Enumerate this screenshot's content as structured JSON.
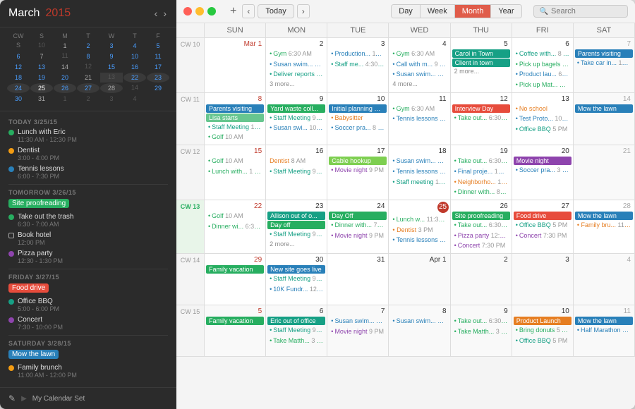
{
  "sidebar": {
    "title": "March",
    "year": "2015",
    "today_label": "TODAY 3/25/15",
    "tomorrow_label": "TOMORROW 3/26/15",
    "friday_label": "FRIDAY 3/27/15",
    "saturday_label": "SATURDAY 3/28/15",
    "today_events": [
      {
        "name": "Lunch with Eric",
        "time": "11:30 AM - 12:30 PM",
        "color": "green"
      },
      {
        "name": "Dentist",
        "time": "3:00 - 4:00 PM",
        "color": "yellow"
      },
      {
        "name": "Tennis lessons",
        "time": "6:00 - 7:30 PM",
        "color": "blue"
      }
    ],
    "tomorrow_events": [
      {
        "name": "Site proofreading",
        "time": "all-day",
        "color": "green",
        "allday": true
      },
      {
        "name": "Take out the trash",
        "time": "6:30 - 7:00 AM",
        "color": "green"
      },
      {
        "name": "Book hotel",
        "time": "12:00 PM",
        "color": "square"
      },
      {
        "name": "Pizza party",
        "time": "12:30 - 1:30 PM",
        "color": "purple"
      }
    ],
    "friday_events": [
      {
        "name": "Food drive",
        "time": "all-day",
        "color": "red",
        "allday": true
      },
      {
        "name": "Office BBQ",
        "time": "5:00 - 6:00 PM",
        "color": "teal"
      },
      {
        "name": "Concert",
        "time": "7:30 - 10:00 PM",
        "color": "purple"
      }
    ],
    "saturday_events": [
      {
        "name": "Mow the lawn",
        "time": "all-day",
        "color": "blue",
        "allday": true
      },
      {
        "name": "Family brunch",
        "time": "11:00 AM - 12:00 PM",
        "color": "yellow"
      }
    ],
    "footer": "My Calendar Set"
  },
  "toolbar": {
    "today_btn": "Today",
    "views": [
      "Day",
      "Week",
      "Month",
      "Year"
    ],
    "active_view": "Month",
    "search_placeholder": "Search",
    "add_icon": "+"
  },
  "calendar": {
    "day_headers": [
      "CW",
      "SUN",
      "MON",
      "TUE",
      "WED",
      "THU",
      "FRI",
      "SAT"
    ],
    "weeks": [
      {
        "cw": "CW 10",
        "days": [
          {
            "num": "Mar 1",
            "events": []
          },
          {
            "num": "2",
            "events": [
              {
                "text": "Gym 6:30 AM",
                "color": "green"
              },
              {
                "text": "Susan swim... 9 AM",
                "color": "blue"
              },
              {
                "text": "Deliver reports 9 AM",
                "color": "teal"
              },
              {
                "text": "3 more...",
                "more": true
              }
            ]
          },
          {
            "num": "3",
            "events": [
              {
                "text": "Production... 11 AM",
                "color": "blue"
              },
              {
                "text": "Staff me... 4:30 PM",
                "color": "teal"
              }
            ]
          },
          {
            "num": "4",
            "events": [
              {
                "text": "Gym 6:30 AM",
                "color": "green"
              },
              {
                "text": "Call with m... 9 AM",
                "color": "blue"
              },
              {
                "text": "Susan swim... 9 AM",
                "color": "blue"
              },
              {
                "text": "4 more...",
                "more": true
              }
            ]
          },
          {
            "num": "5",
            "events": [
              {
                "text": "Carol in Town",
                "color": "block-teal"
              },
              {
                "text": "Client in town",
                "color": "block-teal"
              },
              {
                "text": "2 more...",
                "more": true
              }
            ]
          },
          {
            "num": "6",
            "events": [
              {
                "text": "Coffee with... 8 AM",
                "color": "teal"
              },
              {
                "text": "Pick up bagels 9 AM",
                "color": "green"
              },
              {
                "text": "Product lau... 6:30 AM",
                "color": "blue"
              },
              {
                "text": "Pick up Mat... 10 AM",
                "color": "green"
              }
            ]
          },
          {
            "num": "7",
            "events": [
              {
                "text": "Parents visiting",
                "color": "block-blue"
              },
              {
                "text": "Take car in... 12 PM",
                "color": "blue"
              }
            ]
          }
        ]
      },
      {
        "cw": "CW 11",
        "days": [
          {
            "num": "8",
            "events": [
              {
                "text": "Parents visiting",
                "color": "block-blue"
              },
              {
                "text": "Golf 10 AM",
                "color": "green"
              },
              {
                "text": "Staff Meeting 10 AM",
                "color": "teal"
              },
              {
                "text": "Golf 10 AM",
                "color": "green"
              }
            ]
          },
          {
            "num": "9",
            "events": [
              {
                "text": "Yard waste coll... ",
                "color": "block-green"
              },
              {
                "text": "Staff Meeting 9 AM",
                "color": "teal"
              },
              {
                "text": "Susan swi... 10 AM",
                "color": "blue"
              }
            ]
          },
          {
            "num": "10",
            "events": [
              {
                "text": "Initial planning meeting",
                "color": "block-blue"
              },
              {
                "text": "Babysitter",
                "color": "orange"
              },
              {
                "text": "Soccer pra... 8 PM",
                "color": "blue"
              }
            ]
          },
          {
            "num": "11",
            "events": [
              {
                "text": "Gym 6:30 AM",
                "color": "green"
              },
              {
                "text": "Tennis lessons 6 PM",
                "color": "blue"
              }
            ]
          },
          {
            "num": "12",
            "events": [
              {
                "text": "Interview Day",
                "color": "block-red"
              },
              {
                "text": "Take out... 6:30 AM",
                "color": "green"
              }
            ]
          },
          {
            "num": "13",
            "events": [
              {
                "text": "No school",
                "color": "orange"
              },
              {
                "text": "Test Proto... 10 AM",
                "color": "blue"
              },
              {
                "text": "Office BBQ 5 PM",
                "color": "teal"
              }
            ]
          },
          {
            "num": "14",
            "events": [
              {
                "text": "Mow the lawn",
                "color": "block-blue"
              }
            ]
          }
        ]
      },
      {
        "cw": "CW 12",
        "days": [
          {
            "num": "15",
            "events": [
              {
                "text": "Golf 10 AM",
                "color": "green"
              },
              {
                "text": "Lunch with... 1 PM",
                "color": "green"
              }
            ]
          },
          {
            "num": "16",
            "events": [
              {
                "text": "Dentist 8 AM",
                "color": "yellow"
              },
              {
                "text": "Staff Meeting 9 AM",
                "color": "teal"
              }
            ]
          },
          {
            "num": "17",
            "events": [
              {
                "text": "Cable hookup",
                "color": "block-lime"
              },
              {
                "text": "Movie night 9 PM",
                "color": "purple"
              }
            ]
          },
          {
            "num": "18",
            "events": [
              {
                "text": "Susan swim... 8 AM",
                "color": "blue"
              },
              {
                "text": "Tennis lessons 9 PM",
                "color": "blue"
              },
              {
                "text": "Staff meeting 1 PM",
                "color": "teal"
              }
            ]
          },
          {
            "num": "19",
            "events": [
              {
                "text": "Take out... 6:30 AM",
                "color": "green"
              },
              {
                "text": "1 Final proje... 12 PM",
                "color": "blue"
              },
              {
                "text": "Neighborho... 1 PM",
                "color": "orange"
              },
              {
                "text": "Dinner with... 8 PM",
                "color": "green"
              }
            ]
          },
          {
            "num": "20",
            "events": [
              {
                "text": "Movie night",
                "color": "block-purple"
              },
              {
                "text": "Soccer pra... 3 PM",
                "color": "blue"
              }
            ]
          },
          {
            "num": "21",
            "events": []
          }
        ]
      },
      {
        "cw": "CW 13",
        "days": [
          {
            "num": "22",
            "events": [
              {
                "text": "Golf 10 AM",
                "color": "green"
              },
              {
                "text": "Dinner wi... 6:30 PM",
                "color": "green"
              }
            ]
          },
          {
            "num": "23",
            "events": [
              {
                "text": "Allison out of o...",
                "color": "block-teal"
              },
              {
                "text": "Day off",
                "color": "block-green"
              },
              {
                "text": "Staff Meeting 9 AM",
                "color": "teal"
              },
              {
                "text": "2 more...",
                "more": true
              }
            ]
          },
          {
            "num": "24",
            "events": [
              {
                "text": "Day Off",
                "color": "block-green"
              },
              {
                "text": "Dinner with... 7 PM",
                "color": "green"
              },
              {
                "text": "Movie night 9 PM",
                "color": "purple"
              }
            ]
          },
          {
            "num": "25",
            "today": true,
            "events": [
              {
                "text": "Lunch w... 11:30 AM",
                "color": "green"
              },
              {
                "text": "Dentist 3 PM",
                "color": "yellow"
              },
              {
                "text": "Tennis lessons 9 PM",
                "color": "blue"
              }
            ]
          },
          {
            "num": "26",
            "events": [
              {
                "text": "Site proofreading",
                "color": "block-green"
              },
              {
                "text": "Take out... 6:30 AM",
                "color": "green"
              },
              {
                "text": "Pizza party 12:30 PM",
                "color": "purple"
              },
              {
                "text": "Concert 7:30 PM",
                "color": "purple"
              }
            ]
          },
          {
            "num": "27",
            "events": [
              {
                "text": "Food drive",
                "color": "block-red"
              },
              {
                "text": "Office BBQ 5 PM",
                "color": "teal"
              },
              {
                "text": "Concert 7:30 PM",
                "color": "purple"
              }
            ]
          },
          {
            "num": "28",
            "events": [
              {
                "text": "Mow the lawn",
                "color": "block-blue"
              },
              {
                "text": "Family bru... 11 AM",
                "color": "yellow"
              }
            ]
          }
        ]
      },
      {
        "cw": "CW 14",
        "days": [
          {
            "num": "29",
            "events": [
              {
                "text": "Family vacation",
                "color": "block-green"
              }
            ]
          },
          {
            "num": "30",
            "events": [
              {
                "text": "New site goes live",
                "color": "block-blue"
              },
              {
                "text": "Staff Meeting 9 AM",
                "color": "teal"
              },
              {
                "text": "10K Fundr... 12 PM",
                "color": "blue"
              }
            ]
          },
          {
            "num": "31",
            "events": []
          },
          {
            "num": "Apr 1",
            "other": true,
            "events": []
          },
          {
            "num": "2",
            "other": true,
            "events": []
          },
          {
            "num": "3",
            "other": true,
            "events": []
          },
          {
            "num": "4",
            "other": true,
            "events": []
          }
        ]
      },
      {
        "cw": "CW 15",
        "days": [
          {
            "num": "5",
            "other": true,
            "events": [
              {
                "text": "Family vacation",
                "color": "block-green"
              }
            ]
          },
          {
            "num": "6",
            "other": true,
            "events": [
              {
                "text": "Eric out of office",
                "color": "block-teal"
              },
              {
                "text": "Staff Meeting 9 AM",
                "color": "teal"
              },
              {
                "text": "Take Matth... 3 PM",
                "color": "green"
              }
            ]
          },
          {
            "num": "7",
            "other": true,
            "events": [
              {
                "text": "Susan swim... 9 AM",
                "color": "blue"
              },
              {
                "text": "Movie night 9 PM",
                "color": "purple"
              }
            ]
          },
          {
            "num": "8",
            "other": true,
            "events": [
              {
                "text": "Susan swim... 9 AM",
                "color": "blue"
              }
            ]
          },
          {
            "num": "9",
            "other": true,
            "events": [
              {
                "text": "Take out... 6:30 AM",
                "color": "green"
              },
              {
                "text": "Take Matth... 3 PM",
                "color": "green"
              }
            ]
          },
          {
            "num": "10",
            "other": true,
            "events": [
              {
                "text": "Product Launch",
                "color": "block-orange"
              },
              {
                "text": "Bring donuts 5 AM",
                "color": "green"
              },
              {
                "text": "Office BBQ 5 PM",
                "color": "teal"
              }
            ]
          },
          {
            "num": "11",
            "other": true,
            "events": [
              {
                "text": "Mow the lawn",
                "color": "block-blue"
              },
              {
                "text": "Half Marathon 9 AM",
                "color": "blue"
              }
            ]
          }
        ]
      }
    ]
  }
}
